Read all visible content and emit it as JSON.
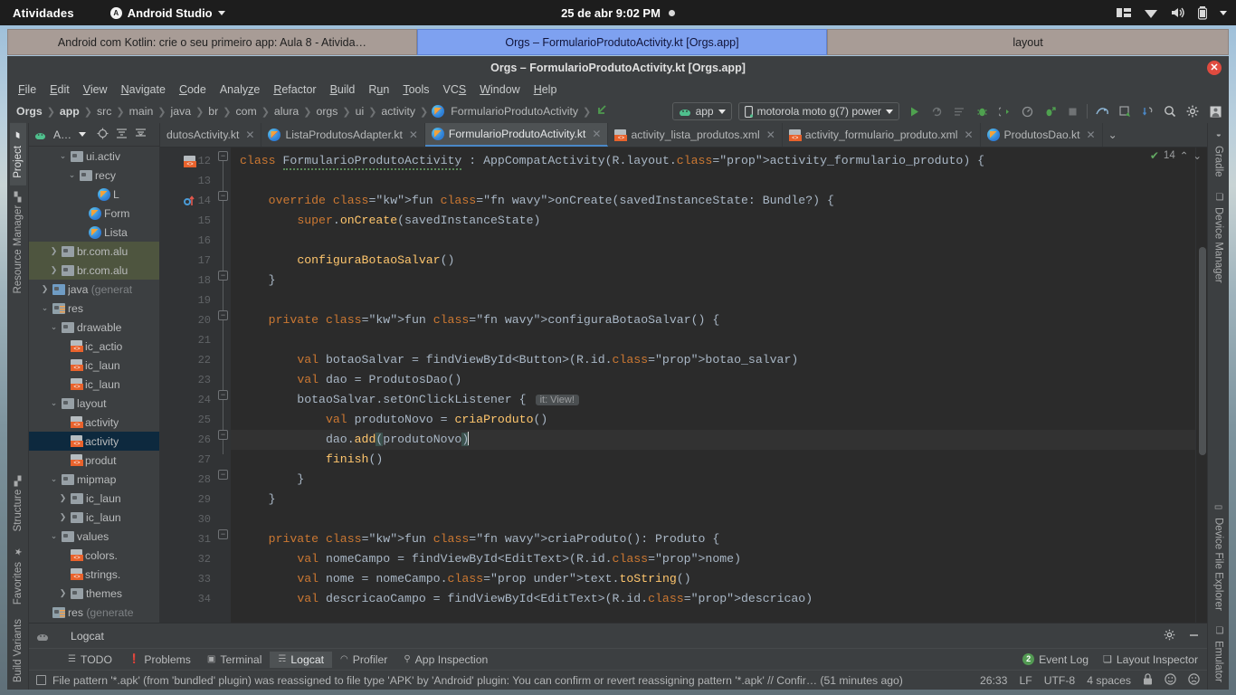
{
  "gnome": {
    "activities": "Atividades",
    "app_name": "Android Studio",
    "app_badge": "A",
    "datetime": "25 de abr   9:02 PM",
    "icons": [
      "display-icon",
      "wifi-icon",
      "volume-icon",
      "battery-icon",
      "chevron-down-icon"
    ]
  },
  "taskbar": [
    {
      "label": "Android com Kotlin: crie o seu primeiro app: Aula 8 - Ativida…",
      "active": false
    },
    {
      "label": "Orgs – FormularioProdutoActivity.kt [Orgs.app]",
      "active": true
    },
    {
      "label": "layout",
      "active": false
    }
  ],
  "window": {
    "title": "Orgs – FormularioProdutoActivity.kt [Orgs.app]",
    "close_label": "✕"
  },
  "menu": [
    "File",
    "Edit",
    "View",
    "Navigate",
    "Code",
    "Analyze",
    "Refactor",
    "Build",
    "Run",
    "Tools",
    "VCS",
    "Window",
    "Help"
  ],
  "breadcrumb": [
    "Orgs",
    "app",
    "src",
    "main",
    "java",
    "br",
    "com",
    "alura",
    "orgs",
    "ui",
    "activity",
    "FormularioProdutoActivity"
  ],
  "toolbar": {
    "module_selector": "app",
    "device_selector": "motorola moto g(7) power",
    "icons": [
      "run-icon",
      "apply-changes-icon",
      "apply-code-changes-icon",
      "debug-icon",
      "attach-debugger-icon",
      "profiler-icon",
      "run-profile-icon",
      "stop-icon",
      "avd-manager-icon",
      "sdk-manager-icon",
      "sync-gradle-icon",
      "search-icon",
      "settings-icon",
      "profile-icon"
    ]
  },
  "project_pane": {
    "title": "A…",
    "header_icons": [
      "android-icon",
      "select-opened-file-icon",
      "expand-all-icon",
      "collapse-all-icon"
    ],
    "tree": [
      {
        "indent": 3,
        "twist": "v",
        "icon": "folder",
        "label": "ui.activ"
      },
      {
        "indent": 4,
        "twist": "v",
        "icon": "folder",
        "label": "recy"
      },
      {
        "indent": 6,
        "twist": "",
        "icon": "kotlin",
        "label": "L"
      },
      {
        "indent": 5,
        "twist": "",
        "icon": "kotlin",
        "label": "Form"
      },
      {
        "indent": 5,
        "twist": "",
        "icon": "kotlin",
        "label": "Lista"
      },
      {
        "indent": 2,
        "twist": ">",
        "icon": "folder",
        "label": "br.com.alu",
        "state": "hl"
      },
      {
        "indent": 2,
        "twist": ">",
        "icon": "folder",
        "label": "br.com.alu",
        "state": "hl"
      },
      {
        "indent": 1,
        "twist": ">",
        "icon": "folder-java",
        "label": "java ",
        "dim": "(generat"
      },
      {
        "indent": 1,
        "twist": "v",
        "icon": "folder-res",
        "label": "res"
      },
      {
        "indent": 2,
        "twist": "v",
        "icon": "folder",
        "label": "drawable"
      },
      {
        "indent": 3,
        "twist": "",
        "icon": "xml",
        "label": "ic_actio"
      },
      {
        "indent": 3,
        "twist": "",
        "icon": "xml",
        "label": "ic_laun"
      },
      {
        "indent": 3,
        "twist": "",
        "icon": "xml",
        "label": "ic_laun"
      },
      {
        "indent": 2,
        "twist": "v",
        "icon": "folder",
        "label": "layout"
      },
      {
        "indent": 3,
        "twist": "",
        "icon": "xml",
        "label": "activity"
      },
      {
        "indent": 3,
        "twist": "",
        "icon": "xml",
        "label": "activity",
        "state": "sel"
      },
      {
        "indent": 3,
        "twist": "",
        "icon": "xml",
        "label": "produt"
      },
      {
        "indent": 2,
        "twist": "v",
        "icon": "folder",
        "label": "mipmap"
      },
      {
        "indent": 3,
        "twist": ">",
        "icon": "folder",
        "label": "ic_laun"
      },
      {
        "indent": 3,
        "twist": ">",
        "icon": "folder",
        "label": "ic_laun"
      },
      {
        "indent": 2,
        "twist": "v",
        "icon": "folder",
        "label": "values"
      },
      {
        "indent": 3,
        "twist": "",
        "icon": "xml",
        "label": "colors."
      },
      {
        "indent": 3,
        "twist": "",
        "icon": "xml",
        "label": "strings."
      },
      {
        "indent": 3,
        "twist": ">",
        "icon": "folder",
        "label": "themes"
      },
      {
        "indent": 1,
        "twist": "",
        "icon": "folder-res",
        "label": "res ",
        "dim": "(generate"
      }
    ]
  },
  "editor_tabs": [
    {
      "label": "dutosActivity.kt",
      "icon": "none",
      "active": false
    },
    {
      "label": "ListaProdutosAdapter.kt",
      "icon": "kotlin",
      "active": false
    },
    {
      "label": "FormularioProdutoActivity.kt",
      "icon": "kotlin",
      "active": true
    },
    {
      "label": "activity_lista_produtos.xml",
      "icon": "xml",
      "active": false
    },
    {
      "label": "activity_formulario_produto.xml",
      "icon": "xml",
      "active": false
    },
    {
      "label": "ProdutosDao.kt",
      "icon": "kotlin",
      "active": false
    }
  ],
  "editor": {
    "inspection_count": "14",
    "inspection_icon": "green-check-icon",
    "first_line_number": 12,
    "lines": [
      {
        "n": 12,
        "text": "class FormularioProdutoActivity : AppCompatActivity(R.layout.activity_formulario_produto) {"
      },
      {
        "n": 13,
        "text": ""
      },
      {
        "n": 14,
        "text": "    override fun onCreate(savedInstanceState: Bundle?) {"
      },
      {
        "n": 15,
        "text": "        super.onCreate(savedInstanceState)"
      },
      {
        "n": 16,
        "text": ""
      },
      {
        "n": 17,
        "text": "        configuraBotaoSalvar()"
      },
      {
        "n": 18,
        "text": "    }"
      },
      {
        "n": 19,
        "text": ""
      },
      {
        "n": 20,
        "text": "    private fun configuraBotaoSalvar() {"
      },
      {
        "n": 21,
        "text": ""
      },
      {
        "n": 22,
        "text": "        val botaoSalvar = findViewById<Button>(R.id.botao_salvar)"
      },
      {
        "n": 23,
        "text": "        val dao = ProdutosDao()"
      },
      {
        "n": 24,
        "text": "        botaoSalvar.setOnClickListener {",
        "hint": "it: View!"
      },
      {
        "n": 25,
        "text": "            val produtoNovo = criaProduto()"
      },
      {
        "n": 26,
        "text": "            dao.add(produtoNovo)",
        "current": true
      },
      {
        "n": 27,
        "text": "            finish()"
      },
      {
        "n": 28,
        "text": "        }"
      },
      {
        "n": 29,
        "text": "    }"
      },
      {
        "n": 30,
        "text": ""
      },
      {
        "n": 31,
        "text": "    private fun criaProduto(): Produto {"
      },
      {
        "n": 32,
        "text": "        val nomeCampo = findViewById<EditText>(R.id.nome)"
      },
      {
        "n": 33,
        "text": "        val nome = nomeCampo.text.toString()"
      },
      {
        "n": 34,
        "text": "        val descricaoCampo = findViewById<EditText>(R.id.descricao)"
      }
    ]
  },
  "left_strip": [
    "Project",
    "Resource Manager",
    "Structure",
    "Favorites",
    "Build Variants"
  ],
  "right_strip": [
    "Gradle",
    "Device Manager",
    "Device File Explorer",
    "Emulator"
  ],
  "logcat": {
    "title": "Logcat",
    "settings_icon": "gear-icon",
    "minimize_icon": "minimize-icon"
  },
  "status_tabs": [
    {
      "label": "TODO",
      "icon": "todo-icon",
      "active": false
    },
    {
      "label": "Problems",
      "icon": "problems-icon",
      "active": false
    },
    {
      "label": "Terminal",
      "icon": "terminal-icon",
      "active": false
    },
    {
      "label": "Logcat",
      "icon": "logcat-icon",
      "active": true
    },
    {
      "label": "Profiler",
      "icon": "profiler-icon",
      "active": false
    },
    {
      "label": "App Inspection",
      "icon": "app-inspection-icon",
      "active": false
    }
  ],
  "status_right": {
    "event_log_count": "2",
    "event_log": "Event Log",
    "layout_inspector": "Layout Inspector"
  },
  "status_bar": {
    "message": "File pattern '*.apk' (from 'bundled' plugin) was reassigned to file type 'APK' by 'Android' plugin: You can confirm or revert reassigning pattern '*.apk' // Confir… (51 minutes ago)",
    "caret": "26:33",
    "line_sep": "LF",
    "encoding": "UTF-8",
    "indent": "4 spaces",
    "lock_icon": "lock-icon",
    "face1_icon": "smiley-icon",
    "face2_icon": "frowny-icon"
  },
  "colors": {
    "accent_blue": "#4a88c7",
    "keyword_orange": "#cc7832",
    "function_yellow": "#ffc66d",
    "property_purple": "#9876aa",
    "editor_bg": "#2b2b2b",
    "chrome_bg": "#3c3f41",
    "selection_navy": "#0d293e"
  }
}
